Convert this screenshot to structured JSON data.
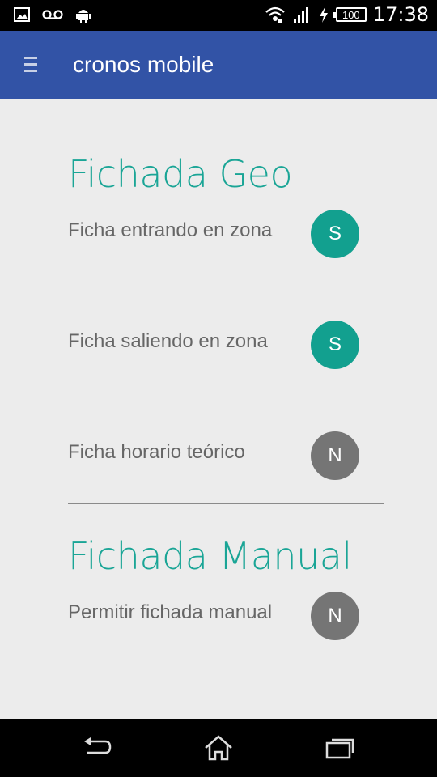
{
  "status_bar": {
    "battery": "100",
    "time": "17:38",
    "left_icons": [
      "image-icon",
      "voicemail-icon",
      "android-icon"
    ],
    "right_icons": [
      "wifi-icon",
      "signal-icon",
      "charging-icon",
      "battery-icon"
    ]
  },
  "app_bar": {
    "title": "cronos mobile",
    "menu_icon": "hamburger-menu-icon"
  },
  "sections": [
    {
      "title": "Fichada Geo",
      "items": [
        {
          "label": "Ficha entrando en zona",
          "value": "S"
        },
        {
          "label": "Ficha saliendo en zona",
          "value": "S"
        },
        {
          "label": "Ficha horario teórico",
          "value": "N"
        }
      ]
    },
    {
      "title": "Fichada Manual",
      "items": [
        {
          "label": "Permitir fichada manual",
          "value": "N"
        }
      ]
    }
  ],
  "colors": {
    "app_bar": "#3253a6",
    "accent": "#1aa596",
    "toggle_on": "#12a08f",
    "toggle_off": "#757575"
  },
  "nav_bar": [
    "back-icon",
    "home-icon",
    "recents-icon"
  ]
}
